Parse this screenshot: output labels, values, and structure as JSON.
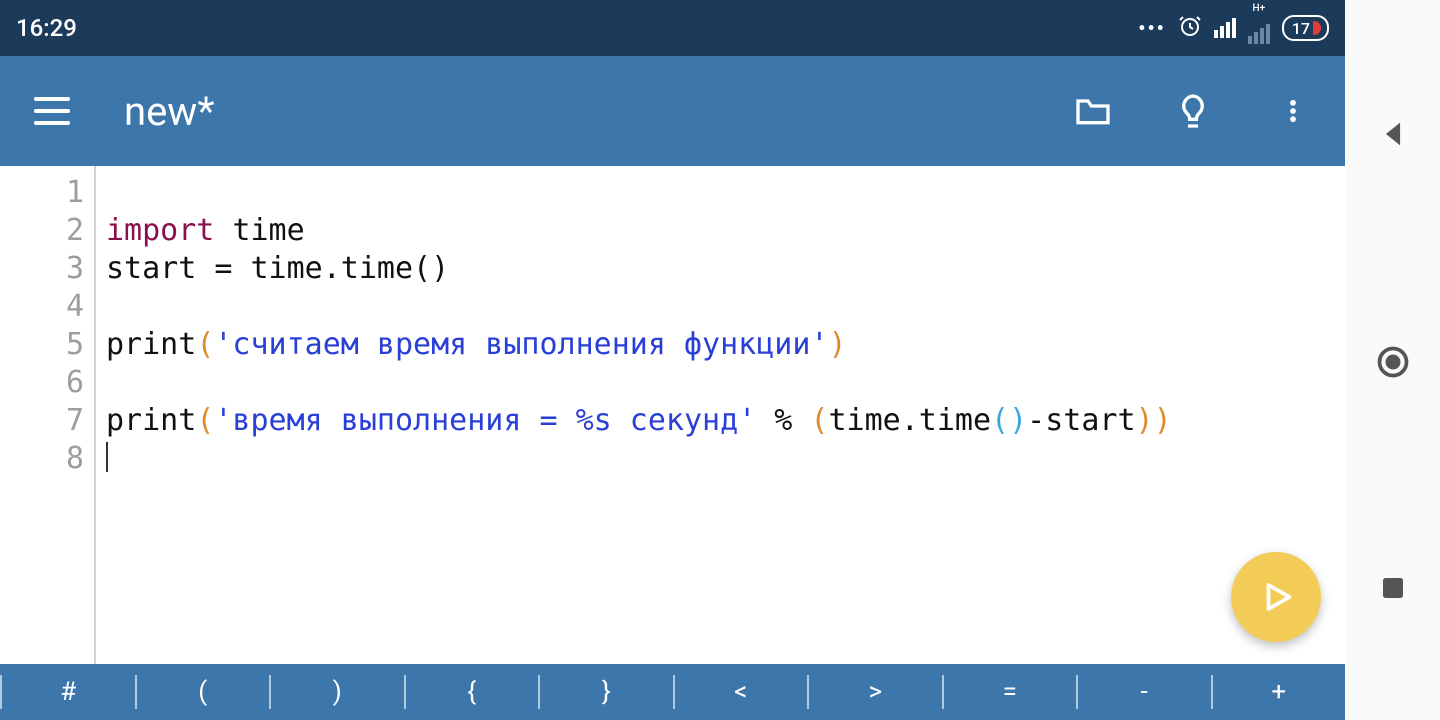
{
  "status": {
    "time": "16:29",
    "battery": "17"
  },
  "appbar": {
    "title": "new*"
  },
  "editor": {
    "line_numbers": [
      "1",
      "2",
      "3",
      "4",
      "5",
      "6",
      "7",
      "8"
    ],
    "lines": {
      "l1": {
        "kw": "import",
        "rest": " time"
      },
      "l2": {
        "text": "start = time.time()"
      },
      "l4": {
        "fn": "print",
        "str": "'считаем время выполнения функции'"
      },
      "l6": {
        "fn": "print",
        "str": "'время выполнения = %s секунд'",
        "mid": " % ",
        "call": "time.time",
        "tail": "-start"
      }
    }
  },
  "keyrow": {
    "keys": [
      "#",
      "(",
      ")",
      "{",
      "}",
      "<",
      ">",
      "=",
      "-",
      "+"
    ]
  }
}
